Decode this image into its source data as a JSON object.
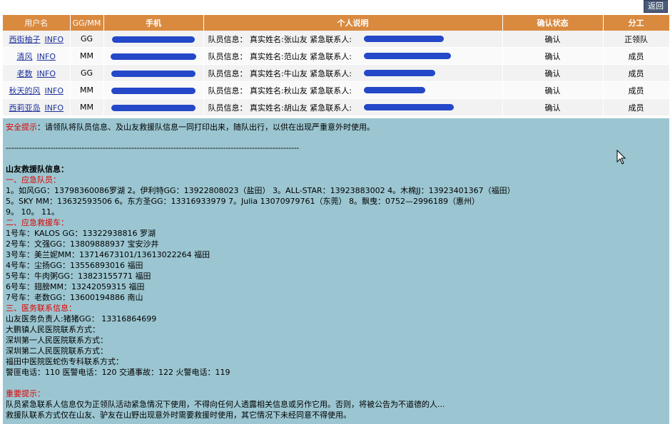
{
  "header": {
    "back_label": "返回"
  },
  "table": {
    "columns": [
      "用户名",
      "GG/MM",
      "手机",
      "个人说明",
      "确认状态",
      "分工"
    ],
    "rows": [
      {
        "user": "西街柚子",
        "info": "INFO",
        "gender": "GG",
        "desc": "队员信息： 真实姓名:张山友 紧急联系人:",
        "status": "确认",
        "role": "正领队"
      },
      {
        "user": "清风",
        "info": "INFO",
        "gender": "MM",
        "desc": "队员信息： 真实姓名:范山友 紧急联系人:",
        "status": "确认",
        "role": "成员"
      },
      {
        "user": "老数",
        "info": "INFO",
        "gender": "GG",
        "desc": "队员信息： 真实姓名:牛山友 紧急联系人:",
        "status": "确认",
        "role": "成员"
      },
      {
        "user": "秋天的风",
        "info": "INFO",
        "gender": "MM",
        "desc": "队员信息： 真实姓名:秋山友 紧急联系人:",
        "status": "确认",
        "role": "成员"
      },
      {
        "user": "西莉亚岛",
        "info": "INFO",
        "gender": "MM",
        "desc": "队员信息： 真实姓名:胡山友 紧急联系人:",
        "status": "确认",
        "role": "成员"
      }
    ]
  },
  "safety": {
    "label": "安全提示",
    "text": "：请领队将队员信息、及山友救援队信息一同打印出来，随队出行，以供在出现严重意外时使用。",
    "divider": "----------------------------------------------------------------------------------------------------------------"
  },
  "rescue": {
    "title": "山友救援队信息：",
    "sec1_title": "一、应急队员：",
    "sec1_lines": [
      "1。如风GG：13798360086罗湖  2。伊利特GG：13922808023（盐田） 3。ALL-STAR：13923883002  4。木棉JJ：13923401367（福田）",
      "5。SKY MM：13632593506  6。东方圣GG：13316933979  7。Julia 13070979761（东莞） 8。飘曳：0752—2996189（惠州）",
      "9。  10。  11。"
    ],
    "sec2_title": "二、应急救援车：",
    "sec2_lines": [
      "1号车：KALOS GG：13322938816 罗湖",
      "2号车：文强GG：13809888937 宝安沙井",
      "3号车：美兰妮MM：13714673101/13613022264 福田",
      "4号车：尘扬GG：13556893016 福田",
      "5号车：牛肉粥GG：13823155771 福田",
      "6号车：翅膀MM：13242059315 福田",
      "7号车：老数GG：13600194886 南山"
    ],
    "sec3_title": "三、医务联系信息：",
    "sec3_lines": [
      "山友医务负责人:猪猪GG： 13316864699",
      "大鹏镇人民医院联系方式：",
      "深圳第一人民医院联系方式：",
      "深圳第二人民医院联系方式：",
      "福田中医院医蛇伤专科联系方式：",
      "警匪电话：110   医警电话：120  交通事故：122   火警电话：119"
    ]
  },
  "important": {
    "label": "重要提示：",
    "lines": [
      "队员紧急联系人信息仅为正领队活动紧急情况下使用，不得向任何人透露相关信息或另作它用。否则，将被公告为不道德的人...",
      "救援队联系方式仅在山友、驴友在山野出现意外时需要救援时使用，其它情况下未经同意不得使用。"
    ]
  },
  "colors": {
    "header_bg": "#d98a3f",
    "panel_bg": "#9bc6d1",
    "redaction": "#2448c8",
    "alert": "#e00000",
    "link": "#1b2f9c"
  },
  "icons": {
    "cursor": "mouse-pointer-icon"
  }
}
